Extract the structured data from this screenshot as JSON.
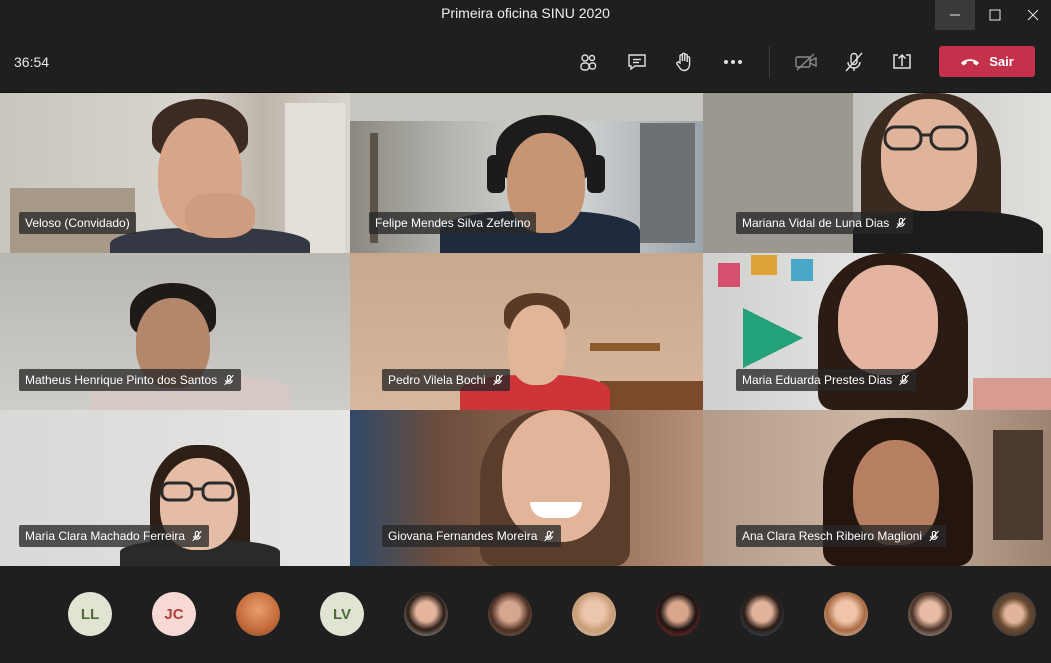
{
  "window": {
    "title": "Primeira oficina SINU 2020"
  },
  "toolbar": {
    "timer": "36:54",
    "leave_label": "Sair",
    "leave_color": "#c4314b",
    "icons": [
      "participants-icon",
      "chat-icon",
      "raise-hand-icon",
      "more-options-icon",
      "camera-off-icon",
      "mic-off-icon",
      "share-screen-icon",
      "hang-up-icon"
    ]
  },
  "participants": [
    {
      "name": "Veloso (Convidado)",
      "muted": false
    },
    {
      "name": "Felipe Mendes Silva Zeferino",
      "muted": false
    },
    {
      "name": "Mariana Vidal de Luna Dias",
      "muted": true
    },
    {
      "name": "Matheus Henrique Pinto dos Santos",
      "muted": true
    },
    {
      "name": "Pedro Vilela Bochi",
      "muted": true
    },
    {
      "name": "Maria Eduarda Prestes Dias",
      "muted": true
    },
    {
      "name": "Maria Clara Machado Ferreira",
      "muted": true
    },
    {
      "name": "Giovana Fernandes Moreira",
      "muted": true
    },
    {
      "name": "Ana Clara Resch Ribeiro Maglioni",
      "muted": true
    }
  ],
  "overflow_avatars": [
    {
      "initials": "LL"
    },
    {
      "initials": "JC"
    },
    {
      "initials": ""
    },
    {
      "initials": "LV"
    },
    {
      "initials": ""
    },
    {
      "initials": ""
    },
    {
      "initials": ""
    },
    {
      "initials": ""
    },
    {
      "initials": ""
    },
    {
      "initials": ""
    },
    {
      "initials": ""
    },
    {
      "initials": ""
    }
  ]
}
